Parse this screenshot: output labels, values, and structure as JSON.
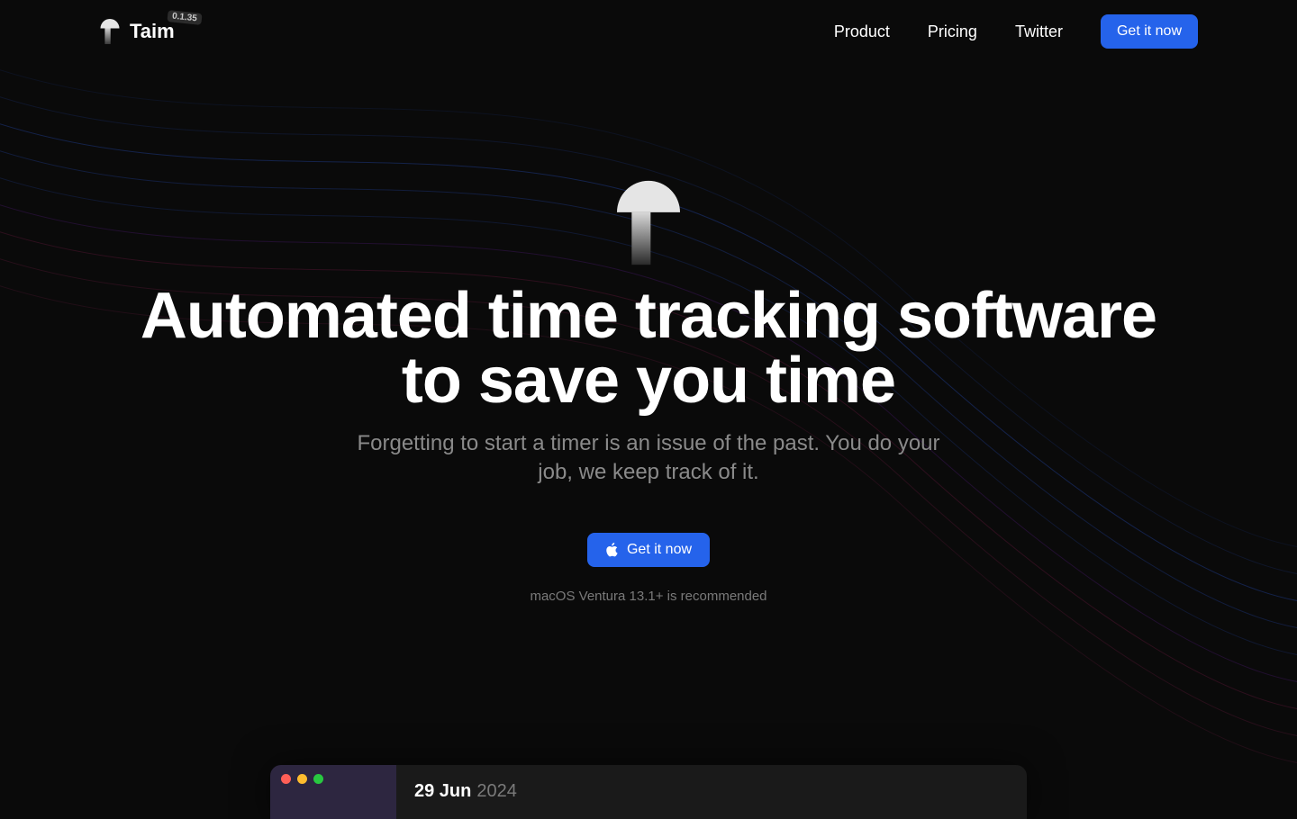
{
  "header": {
    "brand": "Taim",
    "version": "0.1.35",
    "nav": [
      {
        "label": "Product"
      },
      {
        "label": "Pricing"
      },
      {
        "label": "Twitter"
      }
    ],
    "cta": "Get it now"
  },
  "hero": {
    "title": "Automated time tracking software\nto save you time",
    "subtitle": "Forgetting to start a timer is an issue of the past. You do your job, we keep track of it.",
    "cta": "Get it now",
    "note": "macOS Ventura 13.1+ is recommended"
  },
  "preview": {
    "date_strong": "29 Jun",
    "date_year": "2024"
  }
}
